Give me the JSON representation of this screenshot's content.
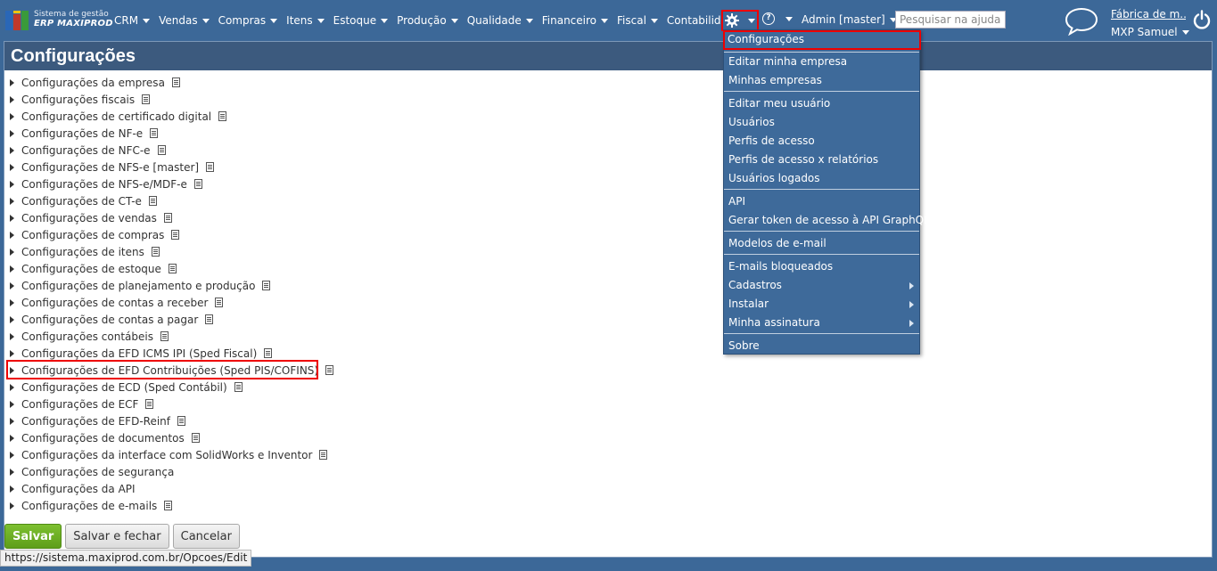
{
  "brand": {
    "line1": "Sistema de gestão",
    "line2": "ERP MAXIPROD"
  },
  "nav": [
    {
      "label": "CRM"
    },
    {
      "label": "Vendas"
    },
    {
      "label": "Compras"
    },
    {
      "label": "Itens"
    },
    {
      "label": "Estoque"
    },
    {
      "label": "Produção"
    },
    {
      "label": "Qualidade"
    },
    {
      "label": "Financeiro"
    },
    {
      "label": "Fiscal"
    },
    {
      "label": "Contabilidade"
    }
  ],
  "admin_label": "Admin [master]",
  "search_placeholder": "Pesquisar na ajuda...",
  "company": {
    "name": "Fábrica de m...",
    "user": "MXP Samuel"
  },
  "page_title": "Configurações",
  "config_items": [
    "Configurações da empresa",
    "Configurações fiscais",
    "Configurações de certificado digital",
    "Configurações de NF-e",
    "Configurações de NFC-e",
    "Configurações de NFS-e [master]",
    "Configurações de NFS-e/MDF-e",
    "Configurações de CT-e",
    "Configurações de vendas",
    "Configurações de compras",
    "Configurações de itens",
    "Configurações de estoque",
    "Configurações de planejamento e produção",
    "Configurações de contas a receber",
    "Configurações de contas a pagar",
    "Configurações contábeis",
    "Configurações da EFD ICMS IPI (Sped Fiscal)",
    "Configurações de EFD Contribuições (Sped PIS/COFINS)",
    "Configurações de ECD (Sped Contábil)",
    "Configurações de ECF",
    "Configurações de EFD-Reinf",
    "Configurações de documentos",
    "Configurações da interface com SolidWorks e Inventor",
    "Configurações de segurança",
    "Configurações da API",
    "Configurações de e-mails"
  ],
  "buttons": {
    "save": "Salvar",
    "save_close": "Salvar e fechar",
    "cancel": "Cancelar"
  },
  "status_url": "https://sistema.maxiprod.com.br/Opcoes/Edit",
  "menu": [
    {
      "label": "Configurações"
    },
    {
      "label": "Editar minha empresa"
    },
    {
      "label": "Minhas empresas"
    },
    {
      "label": "Editar meu usuário"
    },
    {
      "label": "Usuários"
    },
    {
      "label": "Perfis de acesso"
    },
    {
      "label": "Perfis de acesso x relatórios"
    },
    {
      "label": "Usuários logados"
    },
    {
      "label": "API"
    },
    {
      "label": "Gerar token de acesso à API GraphQL"
    },
    {
      "label": "Modelos de e-mail"
    },
    {
      "label": "E-mails bloqueados"
    },
    {
      "label": "Cadastros"
    },
    {
      "label": "Instalar"
    },
    {
      "label": "Minha assinatura"
    },
    {
      "label": "Sobre"
    }
  ],
  "colors": {
    "nav_bg": "#3c6898",
    "title_bg": "#3c5a7e",
    "highlight": "#e00000",
    "save_green": "#6aad22"
  }
}
